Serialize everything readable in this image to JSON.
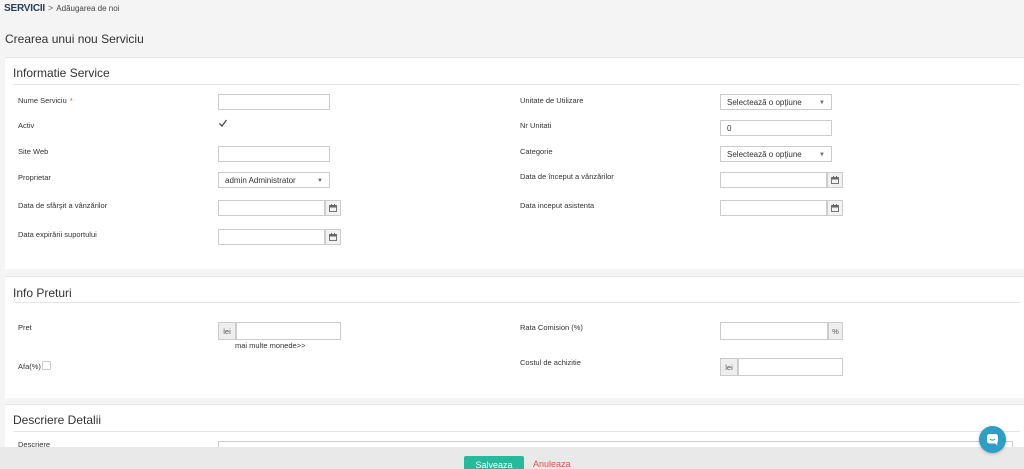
{
  "breadcrumb": {
    "root": "SERVICII",
    "separator": ">",
    "current": "Adăugarea de noi"
  },
  "page_title": "Crearea unui nou Serviciu",
  "sections": {
    "info": {
      "title": "Informatie Service",
      "nume_label": "Nume Serviciu",
      "nume_required": "*",
      "nume_value": "",
      "activ_label": "Activ",
      "activ_checked": true,
      "site_label": "Site Web",
      "site_value": "",
      "proprietar_label": "Proprietar",
      "proprietar_value": "admin Administrator",
      "sfarsit_label": "Data de sfârşit a vânzărilor",
      "sfarsit_value": "",
      "expirare_label": "Data expirării suportului",
      "expirare_value": "",
      "unitate_label": "Unitate de Utilizare",
      "unitate_value": "Selectează o opţiune",
      "nr_label": "Nr Unitati",
      "nr_value": "0",
      "categorie_label": "Categorie",
      "categorie_value": "Selectează o opţiune",
      "inceput_label": "Data de început a vânzărilor",
      "inceput_value": "",
      "asistenta_label": "Data inceput asistenta",
      "asistenta_value": ""
    },
    "preturi": {
      "title": "Info Preturi",
      "pret_label": "Pret",
      "pret_currency": "lei",
      "pret_value": "",
      "more_currencies": "mai multe monede>>",
      "afa_label": "Afa(%)",
      "afa_checked": false,
      "comision_label": "Rata Comision (%)",
      "comision_suffix": "%",
      "comision_value": "",
      "cost_label": "Costul de achizitie",
      "cost_currency": "lei",
      "cost_value": ""
    },
    "detalii": {
      "title": "Descriere Detalii",
      "descriere_label": "Descriere"
    }
  },
  "footer": {
    "save_label": "Salveaza",
    "cancel_label": "Anuleaza"
  },
  "colors": {
    "save_button": "#26b99a",
    "cancel_link": "#d9534f",
    "chat_button": "#2f9ec4",
    "required_star": "#e74c3c"
  },
  "icons": {
    "chat": "chat-bubble-icon",
    "calendar": "calendar-icon",
    "dropdown": "chevron-down-icon",
    "check": "checkmark-icon"
  }
}
